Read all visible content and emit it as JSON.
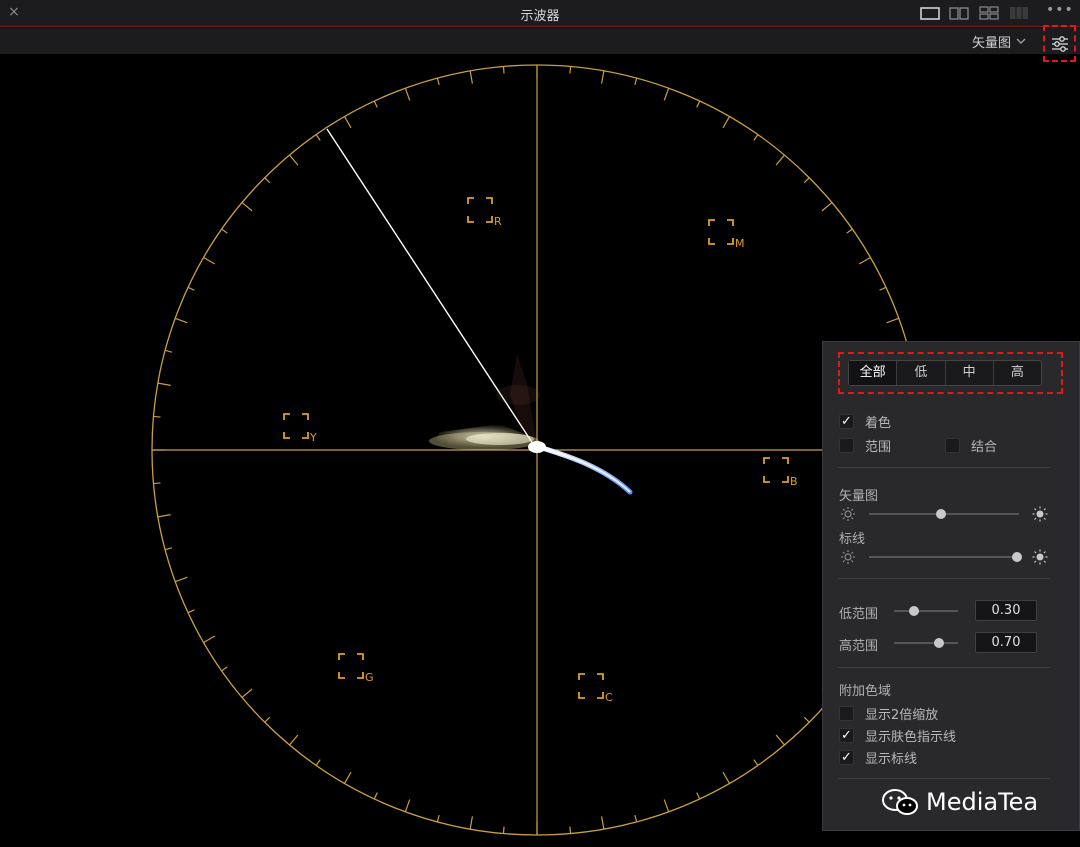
{
  "window": {
    "title": "示波器",
    "close_glyph": "×",
    "more_glyph": "•••"
  },
  "toolbar": {
    "scope_type": "矢量图",
    "chevron_icon": "chevron-down-icon",
    "settings_icon": "settings-sliders-icon"
  },
  "layout_buttons": [
    "single-layout-icon",
    "dual-layout-icon",
    "quad-layout-icon",
    "multi-layout-icon"
  ],
  "vectorscope": {
    "targets": [
      {
        "label": "R"
      },
      {
        "label": "M"
      },
      {
        "label": "Y"
      },
      {
        "label": "B"
      },
      {
        "label": "G"
      },
      {
        "label": "C"
      }
    ],
    "graticule_color": "#c9a040",
    "target_color": "#e0a020",
    "skin_line_color": "#ffffff"
  },
  "panel": {
    "range_tabs": [
      "全部",
      "低",
      "中",
      "高"
    ],
    "active_range": "全部",
    "colorize": {
      "label": "着色",
      "checked": true
    },
    "range": {
      "label": "范围",
      "checked": false
    },
    "combine": {
      "label": "结合",
      "checked": false
    },
    "vectorscope_label": "矢量图",
    "vectorscope_brightness": 0.5,
    "graticule_label": "标线",
    "graticule_brightness": 1.0,
    "low_range": {
      "label": "低范围",
      "value": "0.30"
    },
    "high_range": {
      "label": "高范围",
      "value": "0.70"
    },
    "extra_gamut_title": "附加色域",
    "show_2x_zoom": {
      "label": "显示2倍缩放",
      "checked": false
    },
    "show_skin_line": {
      "label": "显示肤色指示线",
      "checked": true
    },
    "show_graticule": {
      "label": "显示标线",
      "checked": true
    },
    "check_glyph": "✓"
  },
  "watermark": {
    "text": "MediaTea"
  },
  "colors": {
    "accent_red": "#e01818",
    "panel_bg": "#29292c",
    "title_bg": "#1c1c1f"
  }
}
